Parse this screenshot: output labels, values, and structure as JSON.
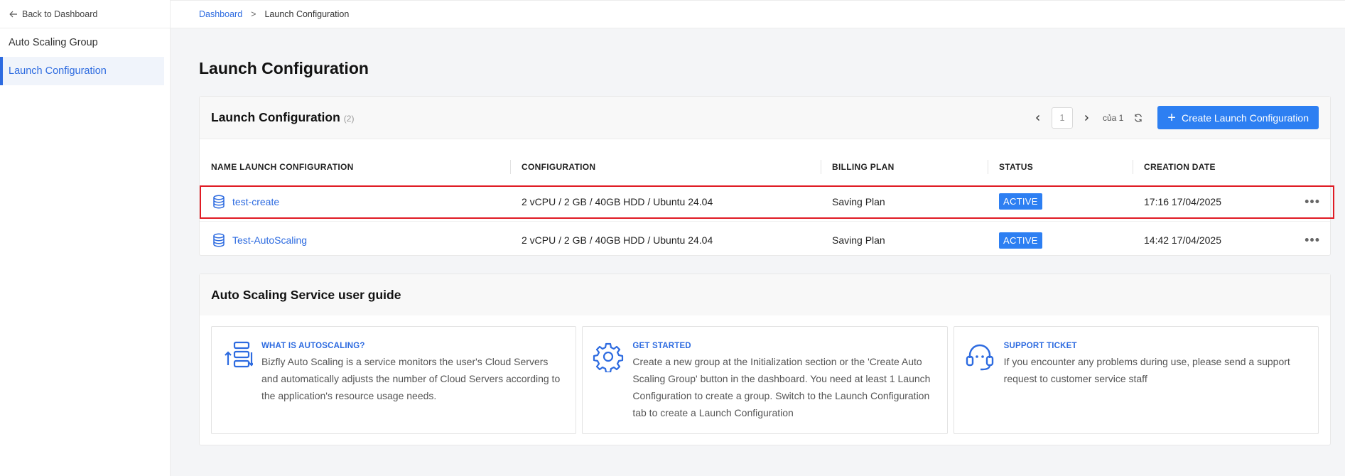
{
  "sidebar": {
    "back_label": "Back to Dashboard",
    "items": [
      {
        "label": "Auto Scaling Group"
      },
      {
        "label": "Launch Configuration"
      }
    ]
  },
  "breadcrumb": {
    "home": "Dashboard",
    "sep": ">",
    "current": "Launch Configuration"
  },
  "page": {
    "title": "Launch Configuration"
  },
  "lc_card": {
    "title": "Launch Configuration",
    "count": "(2)",
    "pager": {
      "prev": "‹",
      "page_value": "1",
      "next": "›",
      "of_label": "của 1"
    },
    "create_label": "Create Launch Configuration",
    "columns": [
      "NAME LAUNCH CONFIGURATION",
      "CONFIGURATION",
      "BILLING PLAN",
      "STATUS",
      "CREATION DATE"
    ],
    "rows": [
      {
        "name": "test-create",
        "config": "2 vCPU / 2 GB / 40GB HDD / Ubuntu 24.04",
        "billing": "Saving Plan",
        "status": "ACTIVE",
        "date": "17:16 17/04/2025"
      },
      {
        "name": "Test-AutoScaling",
        "config": "2 vCPU / 2 GB / 40GB HDD / Ubuntu 24.04",
        "billing": "Saving Plan",
        "status": "ACTIVE",
        "date": "14:42 17/04/2025"
      }
    ],
    "more_label": "•••"
  },
  "guide": {
    "title": "Auto Scaling Service user guide",
    "items": [
      {
        "heading": "WHAT IS AUTOSCALING?",
        "text": "Bizfly Auto Scaling is a service monitors the user's Cloud Servers and automatically adjusts the number of Cloud Servers according to the application's resource usage needs.",
        "icon": "autoscaling-icon"
      },
      {
        "heading": "GET STARTED",
        "text": "Create a new group at the Initialization section or the 'Create Auto Scaling Group' button in the dashboard. You need at least 1 Launch Configuration to create a group. Switch to the Launch Configuration tab to create a Launch Configuration",
        "icon": "gear-icon"
      },
      {
        "heading": "SUPPORT TICKET",
        "text": "If you encounter any problems during use, please send a support request to customer service staff",
        "icon": "headset-icon"
      }
    ]
  },
  "colors": {
    "accent": "#2d7ff2",
    "link": "#2d6be0",
    "highlight": "#e01b24"
  }
}
